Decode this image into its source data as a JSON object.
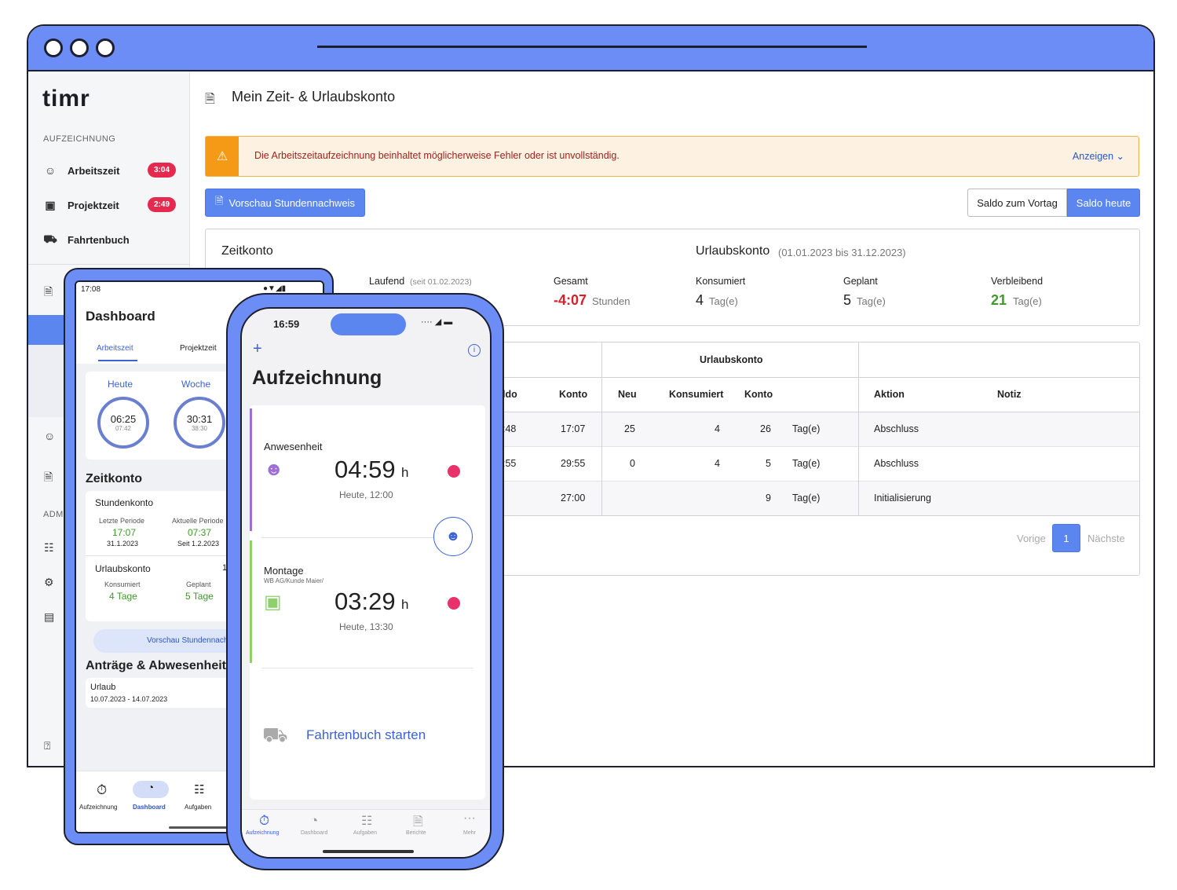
{
  "sidebar": {
    "logo": "timr",
    "section_record": "AUFZEICHNUNG",
    "items": [
      {
        "label": "Arbeitszeit",
        "badge": "3:04"
      },
      {
        "label": "Projektzeit",
        "badge": "2:49"
      },
      {
        "label": "Fahrtenbuch"
      }
    ],
    "section_admin": "ADMI"
  },
  "page": {
    "title": "Mein Zeit- & Urlaubskonto",
    "alert_text": "Die Arbeitszeitaufzeichnung beinhaltet möglicherweise Fehler oder ist unvollständig.",
    "alert_link": "Anzeigen ⌄",
    "preview_button": "Vorschau Stundennachweis",
    "saldo_prev": "Saldo zum Vortag",
    "saldo_today": "Saldo heute"
  },
  "summary": {
    "zeitkonto_title": "Zeitkonto",
    "laufend_label": "Laufend",
    "laufend_sub": "(seit 01.02.2023)",
    "gesamt_label": "Gesamt",
    "gesamt_value": "-4:07",
    "gesamt_unit": "Stunden",
    "urlaub_title": "Urlaubskonto",
    "urlaub_range": "(01.01.2023 bis 31.12.2023)",
    "konsumiert_label": "Konsumiert",
    "konsumiert_value": "4",
    "geplant_label": "Geplant",
    "geplant_value": "5",
    "verbleibend_label": "Verbleibend",
    "verbleibend_value": "21",
    "tage_unit": "Tag(e)"
  },
  "table": {
    "group_urlaub": "Urlaubskonto",
    "headers": {
      "saldo": "ldo",
      "konto": "Konto",
      "neu": "Neu",
      "konsumiert": "Konsumiert",
      "konto2": "Konto",
      "aktion": "Aktion",
      "notiz": "Notiz"
    },
    "rows": [
      {
        "saldo": ":48",
        "konto": "17:07",
        "neu": "25",
        "konsumiert": "4",
        "konto2": "26",
        "unit": "Tag(e)",
        "aktion": "Abschluss"
      },
      {
        "saldo": ":55",
        "konto": "29:55",
        "neu": "0",
        "konsumiert": "4",
        "konto2": "5",
        "unit": "Tag(e)",
        "aktion": "Abschluss"
      },
      {
        "saldo": "",
        "konto": "27:00",
        "neu": "",
        "konsumiert": "",
        "konto2": "9",
        "unit": "Tag(e)",
        "aktion": "Initialisierung"
      }
    ],
    "prev": "Vorige",
    "page": "1",
    "next": "Nächste"
  },
  "tablet": {
    "time": "17:08",
    "title": "Dashboard",
    "tab_active": "Arbeitszeit",
    "tab_other": "Projektzeit",
    "heute_label": "Heute",
    "heute_value": "06:25",
    "heute_sub": "07:42",
    "woche_label": "Woche",
    "woche_value": "30:31",
    "woche_sub": "38:30",
    "zeitkonto": "Zeitkonto",
    "stundenkonto": "Stundenkonto",
    "letzte_label": "Letzte Periode",
    "letzte_value": "17:07",
    "letzte_date": "31.1.2023",
    "aktuelle_label": "Aktuelle Periode",
    "aktuelle_value": "07:37",
    "aktuelle_date": "Seit 1.2.2023",
    "urlaubskonto": "Urlaubskonto",
    "urlaub_extra": "1.",
    "konsumiert_label": "Konsumiert",
    "konsumiert_value": "4 Tage",
    "geplant_label": "Geplant",
    "geplant_value": "5 Tage",
    "vorschau": "Vorschau Stundennachweis",
    "antraege": "Anträge & Abwesenheiten",
    "urlaub_label": "Urlaub",
    "urlaub_dates": "10.07.2023 - 14.07.2023",
    "nav": [
      "Aufzeichnung",
      "Dashboard",
      "Aufgaben"
    ]
  },
  "phone": {
    "time": "16:59",
    "title": "Aufzeichnung",
    "anwesenheit": "Anwesenheit",
    "anw_time": "04:59",
    "anw_unit": "h",
    "anw_since": "Heute, 12:00",
    "montage": "Montage",
    "montage_sub": "WB AG/Kunde Maier/",
    "mon_time": "03:29",
    "mon_unit": "h",
    "mon_since": "Heute, 13:30",
    "fahrtenbuch": "Fahrtenbuch starten",
    "nav": [
      "Aufzeichnung",
      "Dashboard",
      "Aufgaben",
      "Berichte",
      "Mehr"
    ]
  }
}
